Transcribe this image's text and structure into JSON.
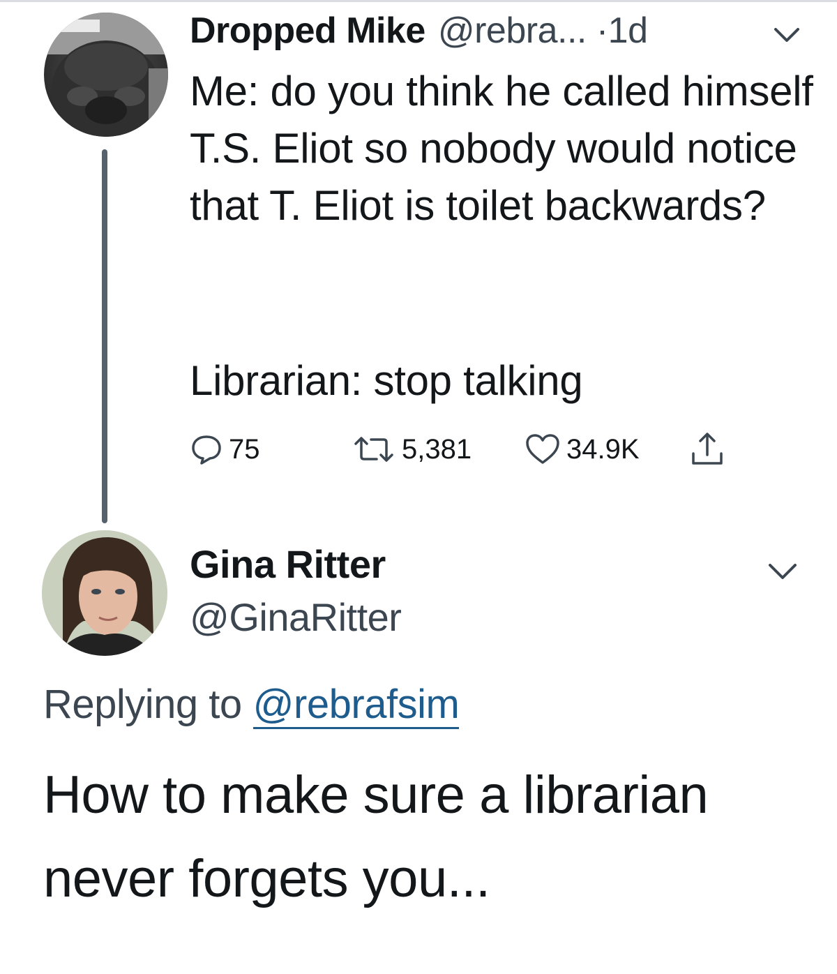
{
  "tweet": {
    "author_name": "Dropped Mike",
    "author_handle": "@rebra...",
    "time": "·1d",
    "text_line1": "Me: do you think he called himself T.S. Eliot so nobody would notice that T. Eliot is toilet backwards?",
    "text_line2": "Librarian: stop talking",
    "replies": "75",
    "retweets": "5,381",
    "likes": "34.9K"
  },
  "reply": {
    "author_name": "Gina Ritter",
    "author_handle": "@GinaRitter",
    "replying_to_label": "Replying to",
    "replying_to_handle": "@rebrafsim",
    "text": "How to make sure a librarian never forgets you..."
  },
  "icons": {
    "reply": "reply-icon",
    "retweet": "retweet-icon",
    "like": "heart-icon",
    "share": "share-icon",
    "menu": "chevron-down-icon"
  },
  "colors": {
    "text": "#14171a",
    "secondary": "#3c4650",
    "link": "#1d5c8c",
    "thread_line": "#56616b"
  }
}
